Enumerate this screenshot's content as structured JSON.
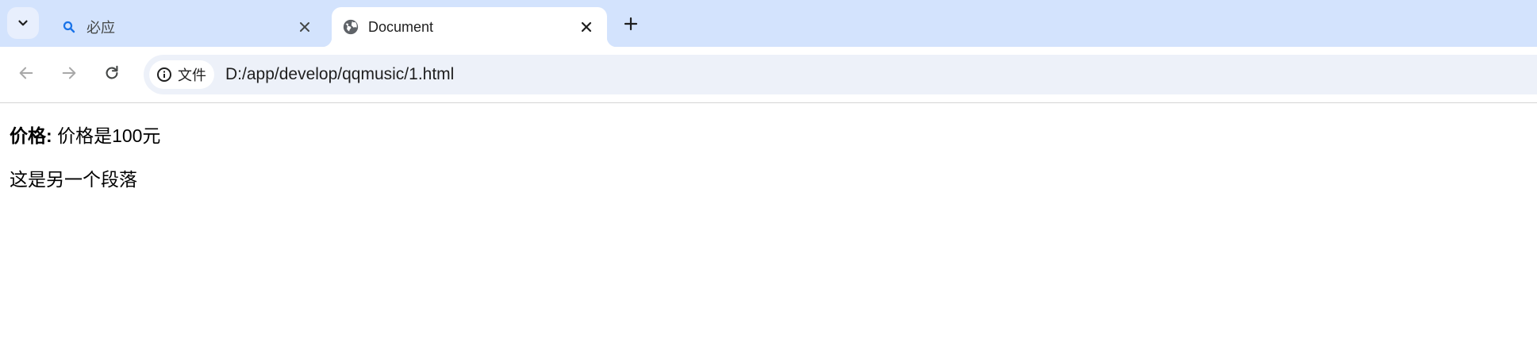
{
  "browser": {
    "tabs": [
      {
        "title": "必应",
        "favicon": "search-icon",
        "active": false
      },
      {
        "title": "Document",
        "favicon": "globe-icon",
        "active": true
      }
    ],
    "security_chip_label": "文件",
    "url": "D:/app/develop/qqmusic/1.html"
  },
  "page": {
    "price_label": "价格:",
    "price_value": "价格是100元",
    "paragraph": "这是另一个段落"
  },
  "colors": {
    "tabstrip_bg": "#d3e3fd",
    "omnibox_bg": "#edf1f9",
    "search_icon": "#1a73e8"
  }
}
